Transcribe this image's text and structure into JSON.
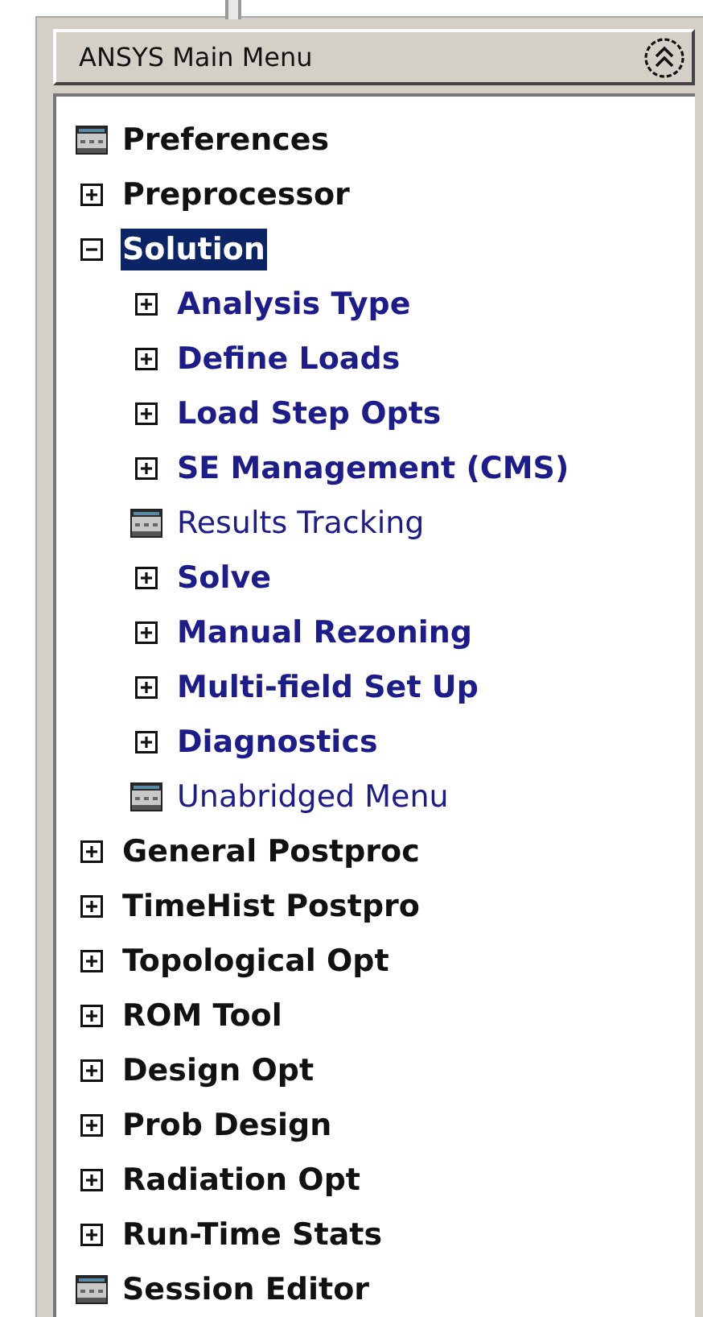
{
  "header": {
    "title": "ANSYS Main Menu"
  },
  "tree": [
    {
      "label": "Preferences",
      "kind": "dialog",
      "selected": false
    },
    {
      "label": "Preprocessor",
      "kind": "folder",
      "expanded": false,
      "selected": false
    },
    {
      "label": "Solution",
      "kind": "folder",
      "expanded": true,
      "selected": true,
      "children": [
        {
          "label": "Analysis Type",
          "kind": "folder",
          "expanded": false,
          "selected": false
        },
        {
          "label": "Define Loads",
          "kind": "folder",
          "expanded": false,
          "selected": false
        },
        {
          "label": "Load Step Opts",
          "kind": "folder",
          "expanded": false,
          "selected": false
        },
        {
          "label": "SE Management (CMS)",
          "kind": "folder",
          "expanded": false,
          "selected": false
        },
        {
          "label": "Results Tracking",
          "kind": "dialog",
          "selected": false
        },
        {
          "label": "Solve",
          "kind": "folder",
          "expanded": false,
          "selected": false
        },
        {
          "label": "Manual Rezoning",
          "kind": "folder",
          "expanded": false,
          "selected": false
        },
        {
          "label": "Multi-field Set Up",
          "kind": "folder",
          "expanded": false,
          "selected": false
        },
        {
          "label": "Diagnostics",
          "kind": "folder",
          "expanded": false,
          "selected": false
        },
        {
          "label": "Unabridged Menu",
          "kind": "dialog",
          "selected": false
        }
      ]
    },
    {
      "label": "General Postproc",
      "kind": "folder",
      "expanded": false,
      "selected": false
    },
    {
      "label": "TimeHist Postpro",
      "kind": "folder",
      "expanded": false,
      "selected": false
    },
    {
      "label": "Topological Opt",
      "kind": "folder",
      "expanded": false,
      "selected": false
    },
    {
      "label": "ROM Tool",
      "kind": "folder",
      "expanded": false,
      "selected": false
    },
    {
      "label": "Design Opt",
      "kind": "folder",
      "expanded": false,
      "selected": false
    },
    {
      "label": "Prob Design",
      "kind": "folder",
      "expanded": false,
      "selected": false
    },
    {
      "label": "Radiation Opt",
      "kind": "folder",
      "expanded": false,
      "selected": false
    },
    {
      "label": "Run-Time Stats",
      "kind": "folder",
      "expanded": false,
      "selected": false
    },
    {
      "label": "Session Editor",
      "kind": "dialog",
      "selected": false
    }
  ]
}
